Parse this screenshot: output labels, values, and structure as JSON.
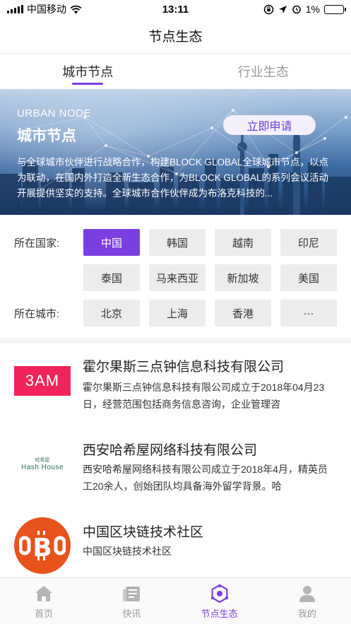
{
  "status_bar": {
    "carrier": "中国移动",
    "time": "13:11",
    "battery": "1%"
  },
  "nav": {
    "title": "节点生态"
  },
  "tabs": [
    {
      "label": "城市节点",
      "active": true
    },
    {
      "label": "行业生态",
      "active": false
    }
  ],
  "banner": {
    "subtitle": "URBAN NODE",
    "title": "城市节点",
    "button": "立即申请",
    "description": "与全球城市伙伴进行战略合作，构建BLOCK GLOBAL全球城市节点，以点为联动，在国内外打造全新生态合作，为BLOCK GLOBAL的系列会议活动开展提供坚实的支持。全球城市合作伙伴成为布洛克科技的..."
  },
  "filters": {
    "country_label": "所在国家:",
    "countries": [
      "中国",
      "韩国",
      "越南",
      "印尼",
      "泰国",
      "马来西亚",
      "新加坡",
      "美国"
    ],
    "selected_country": "中国",
    "city_label": "所在城市:",
    "cities": [
      "北京",
      "上海",
      "香港",
      "···"
    ]
  },
  "companies": [
    {
      "logo_text": "3AM",
      "name": "霍尔果斯三点钟信息科技有限公司",
      "description": "霍尔果斯三点钟信息科技有限公司成立于2018年04月23日，经营范围包括商务信息咨询，企业管理咨"
    },
    {
      "logo_text": "Hash House",
      "logo_sub": "哈希屋",
      "name": "西安哈希屋网络科技有限公司",
      "description": "西安哈希屋网络科技有限公司成立于2018年4月，精英员工20余人，创始团队均具备海外留学背景。哈"
    },
    {
      "logo_text": "B",
      "name": "中国区块链技术社区",
      "description": "中国区块链技术社区"
    }
  ],
  "tabbar": [
    {
      "label": "首页",
      "icon": "home-icon",
      "active": false
    },
    {
      "label": "快讯",
      "icon": "news-icon",
      "active": false
    },
    {
      "label": "节点生态",
      "icon": "node-ecosystem-icon",
      "active": true
    },
    {
      "label": "我的",
      "icon": "profile-icon",
      "active": false
    }
  ],
  "colors": {
    "accent": "#7b3fe0",
    "logo_3am": "#f0245a",
    "logo_chain": "#e8531c",
    "battery_low": "#e0201a"
  }
}
